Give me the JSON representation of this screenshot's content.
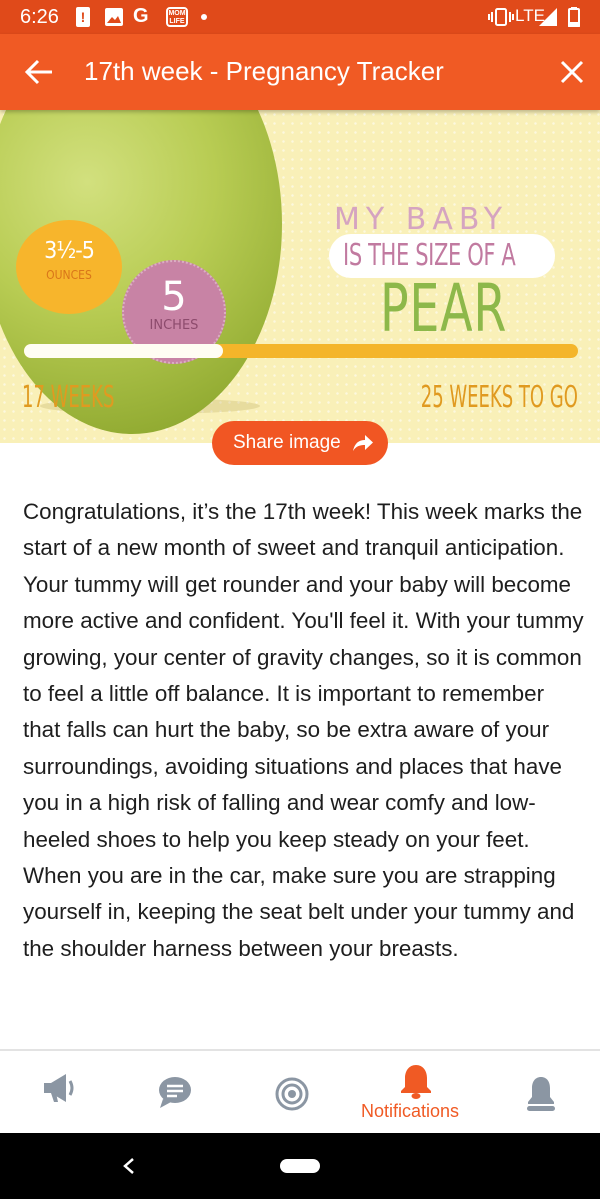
{
  "status_bar": {
    "time": "6:26",
    "network": "LTE",
    "mom_badge": "MOM LIFE",
    "icons": [
      "alert-icon",
      "image-icon",
      "google-icon",
      "mom-life-icon",
      "dot-icon",
      "vibrate-icon",
      "signal-icon",
      "battery-icon"
    ]
  },
  "app_bar": {
    "title": "17th week - Pregnancy Tracker",
    "background": "#f05a24"
  },
  "hero": {
    "partial_heading": "MY BABY",
    "size_line": "IS THE SIZE OF A",
    "fruit": "PEAR",
    "weight_value": "3½-5",
    "weight_unit": "OUNCES",
    "length_value": "5",
    "length_unit": "INCHES",
    "progress_fraction": 0.36,
    "weeks_done": "17 WEEKS",
    "weeks_left": "25 WEEKS TO GO"
  },
  "share_button": {
    "label": "Share image"
  },
  "article": {
    "text": "Congratulations, it’s the 17th week! This week marks the start of a new month of sweet and tranquil anticipation. Your tummy will get rounder and your baby will become more active and confident. You'll feel it. With your tummy growing, your center of gravity changes, so it is common to feel a little off balance. It is important to remember that falls can hurt the baby, so be extra aware of your surroundings, avoiding situations and places that have you in a high risk of falling and wear comfy and low-heeled shoes to help you keep steady on your feet. When you are in the car, make sure you are strapping yourself in, keeping the seat belt under your tummy and the shoulder harness between your breasts."
  },
  "bottom_nav": {
    "items": [
      {
        "icon": "megaphone-icon",
        "label": ""
      },
      {
        "icon": "chat-icon",
        "label": ""
      },
      {
        "icon": "target-icon",
        "label": ""
      },
      {
        "icon": "bell-icon",
        "label": "Notifications",
        "active": true
      },
      {
        "icon": "profile-icon",
        "label": ""
      }
    ],
    "active_color": "#f05a24",
    "inactive_color": "#8b96a3"
  }
}
